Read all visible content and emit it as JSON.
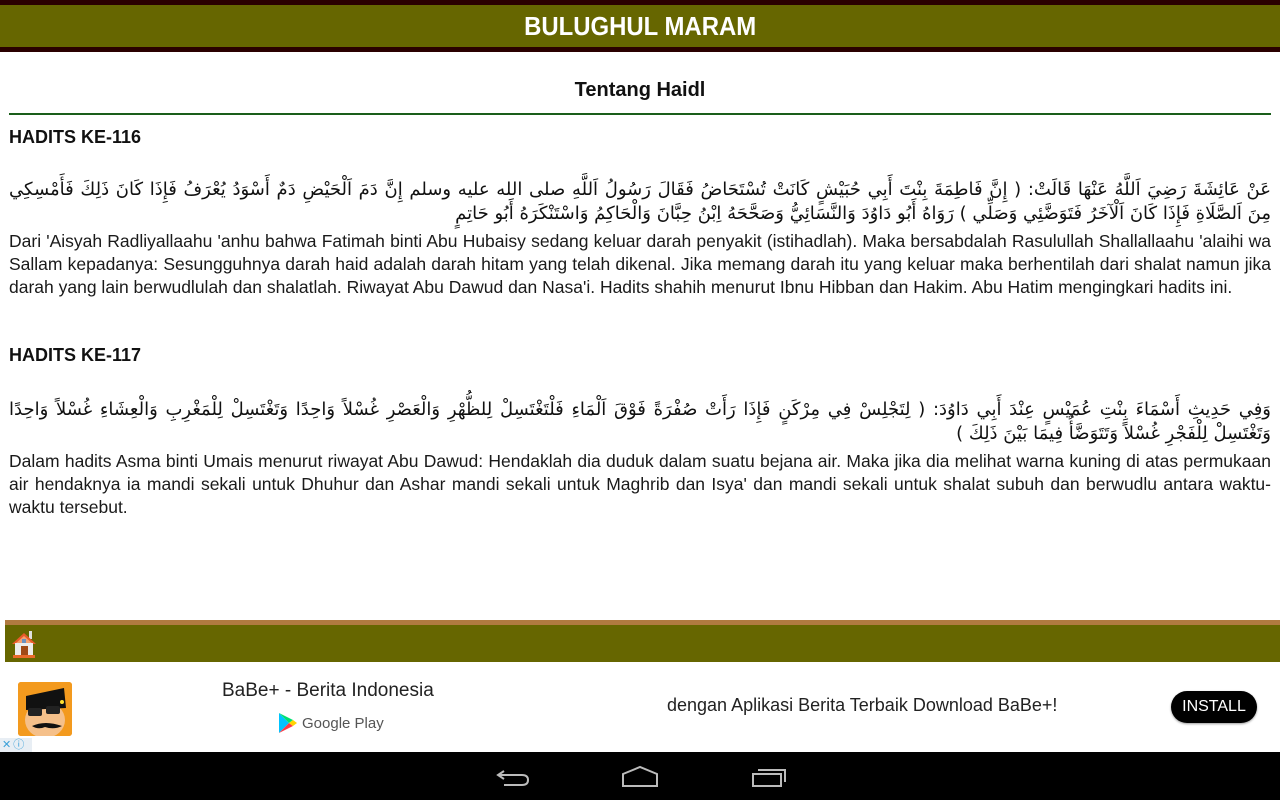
{
  "header": {
    "title": "BULUGHUL MARAM"
  },
  "page": {
    "section_title": "Tentang Haidl",
    "hadiths": [
      {
        "number": "HADITS KE-116",
        "arabic": "عَنْ عَائِشَةَ رَضِيَ اَللَّهُ عَنْهَا قَالَتْ: ( إِنَّ فَاطِمَةَ بِنْتَ أَبِي حُبَيْشٍ كَانَتْ تُسْتَحَاضُ فَقَالَ رَسُولُ اَللَّهِ صلى الله عليه وسلم إِنَّ دَمَ اَلْحَيْضِ دَمٌ أَسْوَدُ يُعْرَفُ فَإِذَا كَانَ ذَلِكَ فَأَمْسِكِي مِنَ اَلصَّلَاةِ فَإِذَا كَانَ اَلْآخَرُ فَتَوَضَّئِي وَصَلِّي ) رَوَاهُ أَبُو دَاوُدَ وَالنَّسَائِيُّ وَصَحَّحَهُ اِبْنُ حِبَّانَ وَالْحَاكِمُ وَاسْتَنْكَرَهُ أَبُو حَاتِمٍ",
        "translation": "Dari 'Aisyah Radliyallaahu 'anhu bahwa Fatimah binti Abu Hubaisy sedang keluar darah penyakit (istihadlah). Maka bersabdalah Rasulullah Shallallaahu 'alaihi wa Sallam kepadanya: Sesungguhnya darah haid adalah darah hitam yang telah dikenal. Jika memang darah itu yang keluar maka berhentilah dari shalat namun jika darah yang lain berwudlulah dan shalatlah. Riwayat Abu Dawud dan Nasa'i. Hadits shahih menurut Ibnu Hibban dan Hakim. Abu Hatim mengingkari hadits ini."
      },
      {
        "number": "HADITS KE-117",
        "arabic": "وَفِي حَدِيثِ أَسْمَاءَ بِنْتِ عُمَيْسٍ عِنْدَ أَبِي دَاوُدَ: ( لِتَجْلِسْ فِي مِرْكَنٍ فَإِذَا رَأَتْ صُفْرَةً فَوْقَ اَلْمَاءِ فَلْتَغْتَسِلْ لِلظُّهْرِ وَالْعَصْرِ غُسْلاً وَاحِدًا وَتَغْتَسِلْ لِلْمَغْرِبِ وَالْعِشَاءِ غُسْلاً وَاحِدًا وَتَغْتَسِلْ لِلْفَجْرِ غُسْلاً وَتَتَوَضَّأُ فِيمَا بَيْنَ ذَلِكَ )",
        "translation": "Dalam hadits Asma binti Umais menurut riwayat Abu Dawud: Hendaklah dia duduk dalam suatu bejana air. Maka jika dia melihat warna kuning di atas permukaan air hendaknya ia mandi sekali untuk Dhuhur dan Ashar mandi sekali untuk Maghrib dan Isya' dan mandi sekali untuk shalat subuh dan berwudlu antara waktu-waktu tersebut."
      }
    ]
  },
  "footer": {
    "home_icon": "home-icon"
  },
  "ad": {
    "app_icon": "babe-app-icon",
    "title": "BaBe+ - Berita Indonesia",
    "store_label": "Google Play",
    "description": "dengan Aplikasi Berita Terbaik Download BaBe+!",
    "install_label": "INSTALL",
    "close_glyph": "✕",
    "info_glyph": "ⓘ"
  },
  "nav": {
    "back": "back-icon",
    "home": "home-icon",
    "recents": "recents-icon"
  },
  "colors": {
    "header_bg": "#666600",
    "header_border": "#2a0000",
    "divider": "#1a5e1a",
    "footer_border": "#b07a40"
  }
}
